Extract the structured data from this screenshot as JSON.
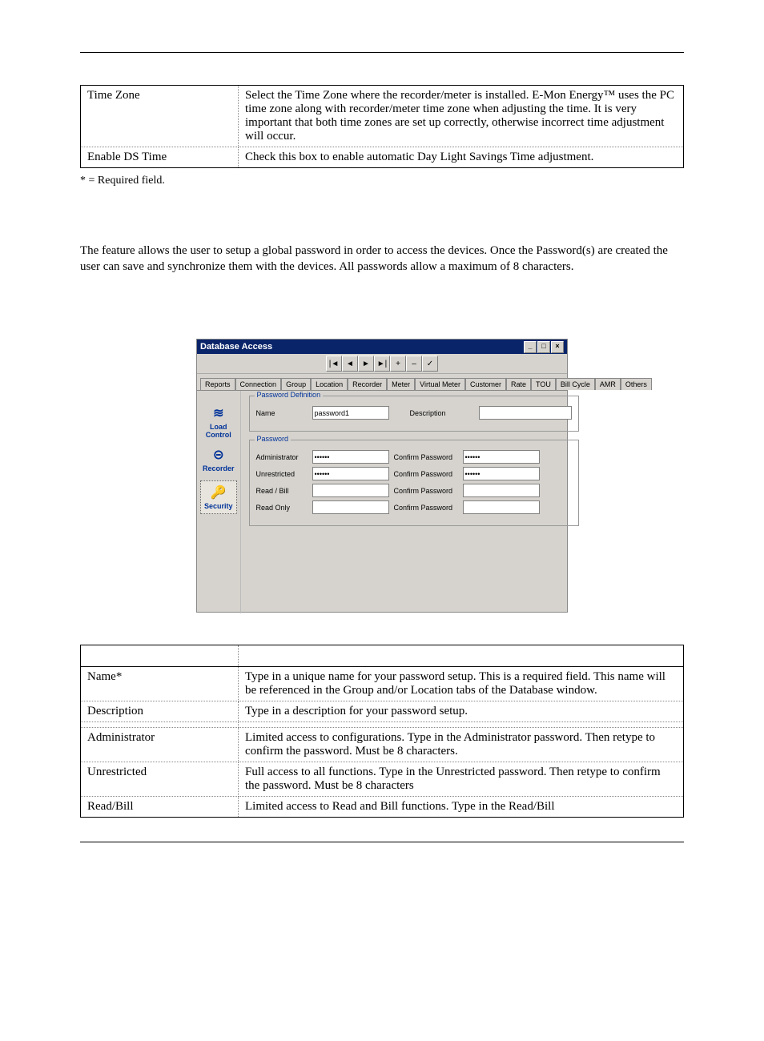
{
  "table1": {
    "r1": {
      "l": "Time Zone",
      "r": "Select the Time Zone where the recorder/meter is installed. E-Mon Energy™ uses the PC time zone along with recorder/meter time zone when adjusting the time. It is very important that both time zones are set up correctly, otherwise incorrect time adjustment will occur."
    },
    "r2": {
      "l": "Enable DS Time",
      "r": "Check this box to enable automatic Day Light Savings Time adjustment."
    }
  },
  "req_note": "* = Required field.",
  "para": "The            feature allows the user to setup a global password in order to access the devices. Once the Password(s) are created the user can save and synchronize them with the devices.  All passwords allow a maximum of 8 characters.",
  "win": {
    "title": "Database Access",
    "wb": {
      "min": "_",
      "max": "□",
      "close": "×"
    },
    "tb": {
      "first": "|◄",
      "prev": "◄",
      "next": "►",
      "last": "►|",
      "add": "+",
      "del": "–",
      "ok": "✓"
    },
    "tabs": {
      "t1": "Reports",
      "t2": "Connection",
      "t3": "Group",
      "t4": "Location",
      "t5": "Recorder",
      "t6": "Meter",
      "t7": "Virtual Meter",
      "t8": "Customer",
      "t9": "Rate",
      "t10": "TOU",
      "t11": "Bill Cycle",
      "t12": "AMR",
      "t13": "Others"
    },
    "side": {
      "s1": "Load Control",
      "s2": "Recorder",
      "s3": "Security",
      "i1": "≋",
      "i2": "⊝",
      "i3": "🔑"
    },
    "g1": {
      "title": "Password Definition",
      "name_l": "Name",
      "name_v": "password1",
      "desc_l": "Description",
      "desc_v": ""
    },
    "g2": {
      "title": "Password",
      "admin_l": "Administrator",
      "admin_v": "••••••",
      "admin_cl": "Confirm Password",
      "admin_cv": "••••••",
      "unr_l": "Unrestricted",
      "unr_v": "••••••",
      "unr_cl": "Confirm Password",
      "unr_cv": "••••••",
      "rb_l": "Read / Bill",
      "rb_v": "",
      "rb_cl": "Confirm Password",
      "rb_cv": "",
      "ro_l": "Read Only",
      "ro_v": "",
      "ro_cl": "Confirm Password",
      "ro_cv": ""
    }
  },
  "table2": {
    "r1": {
      "l": "Name*",
      "r": "Type in a unique name for your password setup. This is a required field. This name will be referenced in the Group and/or Location tabs of the Database window."
    },
    "r2": {
      "l": "Description",
      "r": "Type in a description for your password setup."
    },
    "r3": {
      "l": "Administrator",
      "r": "Limited access to configurations. Type in the Administrator password. Then retype to confirm the password. Must be 8 characters."
    },
    "r4": {
      "l": "Unrestricted",
      "r": "Full access to all functions. Type in the Unrestricted password. Then retype to confirm the password. Must be 8 characters"
    },
    "r5": {
      "l": "Read/Bill",
      "r": "Limited access to Read and Bill functions. Type in the Read/Bill"
    }
  }
}
